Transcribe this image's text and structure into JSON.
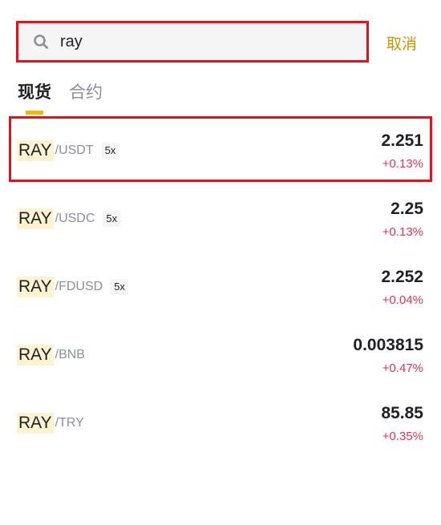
{
  "search": {
    "value": "ray",
    "cancel_label": "取消"
  },
  "tabs": [
    {
      "label": "现货",
      "active": true
    },
    {
      "label": "合约",
      "active": false
    }
  ],
  "pairs": [
    {
      "base": "RAY",
      "quote": "/USDT",
      "leverage": "5x",
      "price": "2.251",
      "change": "+0.13%"
    },
    {
      "base": "RAY",
      "quote": "/USDC",
      "leverage": "5x",
      "price": "2.25",
      "change": "+0.13%"
    },
    {
      "base": "RAY",
      "quote": "/FDUSD",
      "leverage": "5x",
      "price": "2.252",
      "change": "+0.04%"
    },
    {
      "base": "RAY",
      "quote": "/BNB",
      "leverage": "",
      "price": "0.003815",
      "change": "+0.47%"
    },
    {
      "base": "RAY",
      "quote": "/TRY",
      "leverage": "",
      "price": "85.85",
      "change": "+0.35%"
    }
  ],
  "colors": {
    "accent": "#f0b90b",
    "cancel": "#c99400",
    "positive": "#e0315a",
    "highlight_border": "#e8101a"
  },
  "icons": {
    "search": "search-icon"
  }
}
